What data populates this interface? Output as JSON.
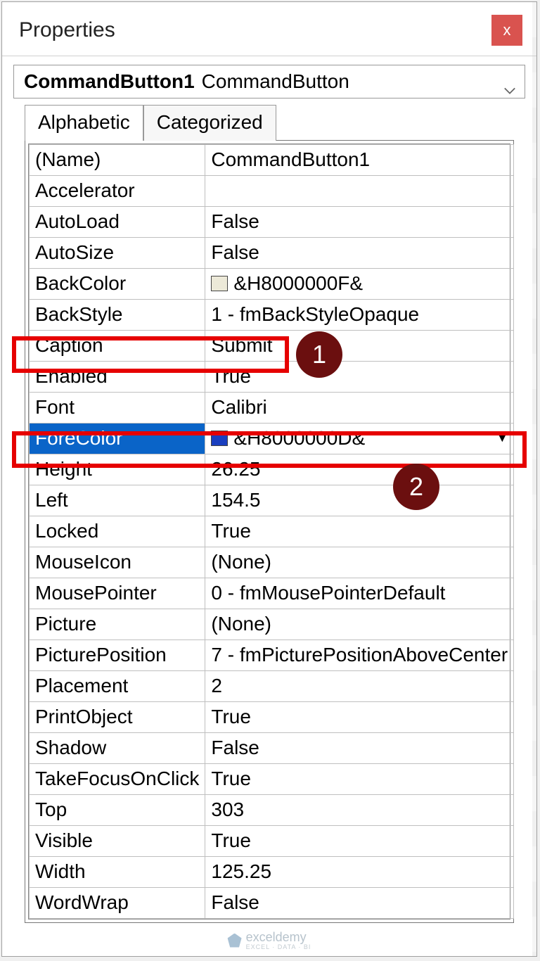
{
  "header": {
    "title": "Properties",
    "close_label": "x"
  },
  "selector": {
    "object_name": "CommandButton1",
    "object_type": "CommandButton"
  },
  "tabs": {
    "alphabetic": "Alphabetic",
    "categorized": "Categorized"
  },
  "swatches": {
    "backcolor": "#ece9d8",
    "forecolor": "#1a3fbf"
  },
  "properties": [
    {
      "name": "(Name)",
      "value": "CommandButton1"
    },
    {
      "name": "Accelerator",
      "value": ""
    },
    {
      "name": "AutoLoad",
      "value": "False"
    },
    {
      "name": "AutoSize",
      "value": "False"
    },
    {
      "name": "BackColor",
      "value": "&H8000000F&",
      "swatch": "backcolor"
    },
    {
      "name": "BackStyle",
      "value": "1 - fmBackStyleOpaque"
    },
    {
      "name": "Caption",
      "value": "Submit"
    },
    {
      "name": "Enabled",
      "value": "True"
    },
    {
      "name": "Font",
      "value": "Calibri"
    },
    {
      "name": "ForeColor",
      "value": "&H8000000D&",
      "swatch": "forecolor",
      "selected": true,
      "dropdown": true
    },
    {
      "name": "Height",
      "value": "26.25"
    },
    {
      "name": "Left",
      "value": "154.5"
    },
    {
      "name": "Locked",
      "value": "True"
    },
    {
      "name": "MouseIcon",
      "value": "(None)"
    },
    {
      "name": "MousePointer",
      "value": "0 - fmMousePointerDefault"
    },
    {
      "name": "Picture",
      "value": "(None)"
    },
    {
      "name": "PicturePosition",
      "value": "7 - fmPicturePositionAboveCenter"
    },
    {
      "name": "Placement",
      "value": "2"
    },
    {
      "name": "PrintObject",
      "value": "True"
    },
    {
      "name": "Shadow",
      "value": "False"
    },
    {
      "name": "TakeFocusOnClick",
      "value": "True"
    },
    {
      "name": "Top",
      "value": "303"
    },
    {
      "name": "Visible",
      "value": "True"
    },
    {
      "name": "Width",
      "value": "125.25"
    },
    {
      "name": "WordWrap",
      "value": "False"
    }
  ],
  "callouts": {
    "one": "1",
    "two": "2"
  },
  "watermark": {
    "brand": "exceldemy",
    "tagline": "EXCEL · DATA · BI"
  }
}
